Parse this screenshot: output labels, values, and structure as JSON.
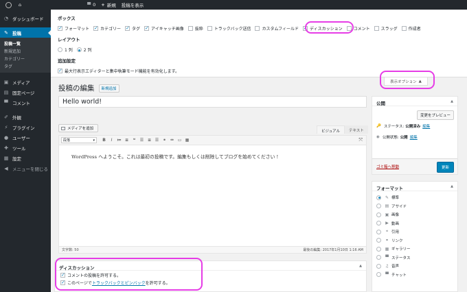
{
  "adminbar": {
    "comments_count": "0",
    "new_label": "新規",
    "view_post": "投稿を表示"
  },
  "sidebar": {
    "items": [
      {
        "label": "ダッシュボード",
        "icon": "dashboard-icon"
      },
      {
        "label": "投稿",
        "icon": "pin-icon"
      },
      {
        "label": "メディア",
        "icon": "media-icon"
      },
      {
        "label": "固定ページ",
        "icon": "page-icon"
      },
      {
        "label": "コメント",
        "icon": "comment-icon"
      },
      {
        "label": "外観",
        "icon": "brush-icon"
      },
      {
        "label": "プラグイン",
        "icon": "plugin-icon"
      },
      {
        "label": "ユーザー",
        "icon": "user-icon"
      },
      {
        "label": "ツール",
        "icon": "wrench-icon"
      },
      {
        "label": "設定",
        "icon": "settings-icon"
      },
      {
        "label": "メニューを閉じる",
        "icon": "collapse-icon"
      }
    ],
    "submenu": [
      "投稿一覧",
      "新規追加",
      "カテゴリー",
      "タグ"
    ]
  },
  "screen_options": {
    "boxes_heading": "ボックス",
    "boxes": [
      {
        "label": "フォーマット",
        "checked": true
      },
      {
        "label": "カテゴリー",
        "checked": true
      },
      {
        "label": "タグ",
        "checked": true
      },
      {
        "label": "アイキャッチ画像",
        "checked": true
      },
      {
        "label": "抜粋",
        "checked": false
      },
      {
        "label": "トラックバック送信",
        "checked": false
      },
      {
        "label": "カスタムフィールド",
        "checked": false
      },
      {
        "label": "ディスカッション",
        "checked": true
      },
      {
        "label": "コメント",
        "checked": false
      },
      {
        "label": "スラッグ",
        "checked": false
      },
      {
        "label": "作成者",
        "checked": false
      }
    ],
    "layout_heading": "レイアウト",
    "layout_1": "1 列",
    "layout_2": "2 列",
    "extra_heading": "追加設定",
    "extra_label": "最大行表示エディターと集中執筆モード機能を有効化します。",
    "toggle_label": "表示オプション"
  },
  "page": {
    "title": "投稿の編集",
    "add_new": "新規追加"
  },
  "post": {
    "title": "Hello world!"
  },
  "editor": {
    "add_media": "メディアを追加",
    "tab_visual": "ビジュアル",
    "tab_text": "テキスト",
    "format_select": "段落",
    "content": "WordPress へようこそ。これは最初の投稿です。編集もしくは削除してブログを始めてください !",
    "word_count": "文字数: 50",
    "last_edit": "最後の編集: 2017年1月10日 1:16 AM"
  },
  "discussion": {
    "heading": "ディスカッション",
    "allow_comments": "コメントの投稿を許可する。",
    "allow_trackbacks_prefix": "このページで",
    "allow_trackbacks_link": "トラックバックとピンバック",
    "allow_trackbacks_suffix": "を許可する。"
  },
  "publish": {
    "heading": "公開",
    "preview": "変更をプレビュー",
    "status_label": "ステータス:",
    "status_value": "公開済み",
    "visibility_label": "公開状態:",
    "visibility_value": "公開",
    "edit": "編集",
    "trash": "ゴミ箱へ移動",
    "update": "更新"
  },
  "formats": {
    "heading": "フォーマット",
    "items": [
      {
        "label": "標準",
        "icon": "pin-icon",
        "selected": true
      },
      {
        "label": "アサイド",
        "icon": "aside-icon",
        "selected": false
      },
      {
        "label": "画像",
        "icon": "image-icon",
        "selected": false
      },
      {
        "label": "動画",
        "icon": "video-icon",
        "selected": false
      },
      {
        "label": "引用",
        "icon": "quote-icon",
        "selected": false
      },
      {
        "label": "リンク",
        "icon": "link-icon",
        "selected": false
      },
      {
        "label": "ギャラリー",
        "icon": "gallery-icon",
        "selected": false
      },
      {
        "label": "ステータス",
        "icon": "status-icon",
        "selected": false
      },
      {
        "label": "音声",
        "icon": "audio-icon",
        "selected": false
      },
      {
        "label": "チャット",
        "icon": "chat-icon",
        "selected": false
      }
    ]
  },
  "colors": {
    "accent": "#0073aa",
    "highlight": "#e63ce6",
    "primary_button": "#0085ba"
  }
}
